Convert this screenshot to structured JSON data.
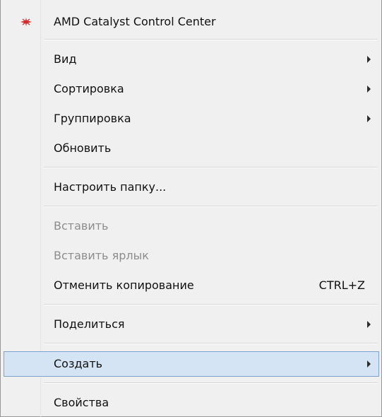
{
  "menu": {
    "items": [
      {
        "label": "AMD Catalyst Control Center",
        "icon": "amd-catalyst-icon"
      },
      {
        "label": "Вид",
        "submenu": true
      },
      {
        "label": "Сортировка",
        "submenu": true
      },
      {
        "label": "Группировка",
        "submenu": true
      },
      {
        "label": "Обновить"
      },
      {
        "label": "Настроить папку..."
      },
      {
        "label": "Вставить",
        "disabled": true
      },
      {
        "label": "Вставить ярлык",
        "disabled": true
      },
      {
        "label": "Отменить копирование",
        "shortcut": "CTRL+Z"
      },
      {
        "label": "Поделиться",
        "submenu": true
      },
      {
        "label": "Создать",
        "submenu": true,
        "highlighted": true
      },
      {
        "label": "Свойства"
      }
    ]
  },
  "colors": {
    "menu_background": "#f0f0f0",
    "highlight_background": "#d5e4f4",
    "highlight_border": "#7da2ce",
    "disabled_text": "#8d8d8d",
    "amd_icon": "#d42a2a"
  }
}
